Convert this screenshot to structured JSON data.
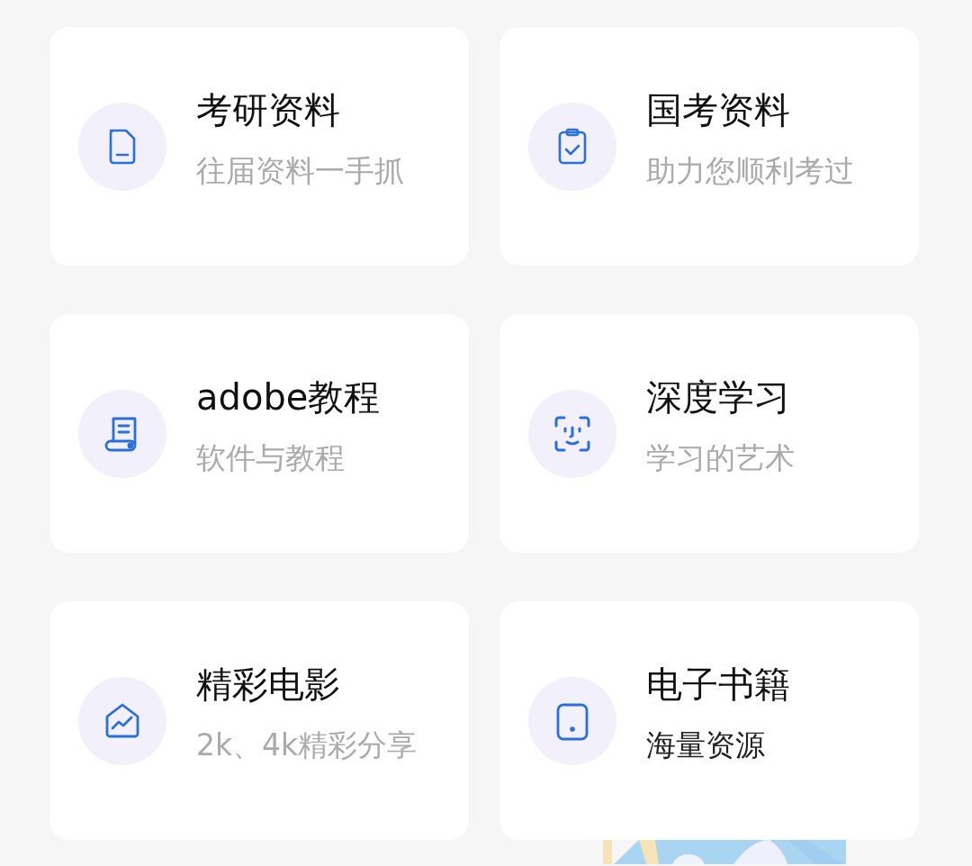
{
  "cards": [
    {
      "title": "考研资料",
      "subtitle": "往届资料一手抓",
      "muted": true
    },
    {
      "title": "国考资料",
      "subtitle": "助力您顺利考过",
      "muted": true
    },
    {
      "title": "adobe教程",
      "subtitle": "软件与教程",
      "muted": true
    },
    {
      "title": "深度学习",
      "subtitle": "学习的艺术",
      "muted": true
    },
    {
      "title": "精彩电影",
      "subtitle": "2k、4k精彩分享",
      "muted": true
    },
    {
      "title": "电子书籍",
      "subtitle": "海量资源",
      "muted": false
    }
  ]
}
